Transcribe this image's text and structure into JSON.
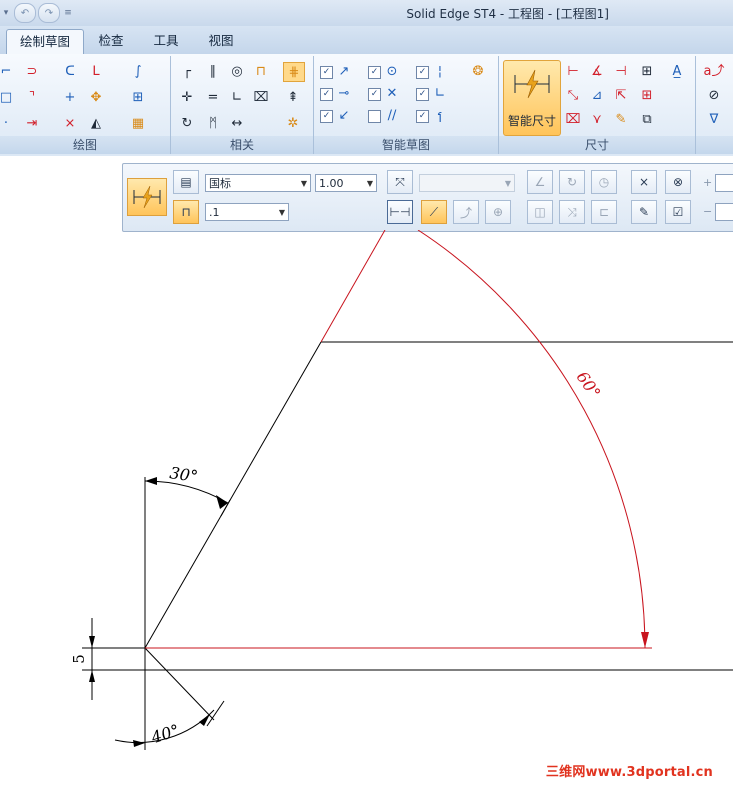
{
  "window": {
    "title": "Solid Edge ST4 - 工程图 - [工程图1]"
  },
  "tabs": [
    {
      "label": "绘制草图",
      "active": true
    },
    {
      "label": "检查",
      "active": false
    },
    {
      "label": "工具",
      "active": false
    },
    {
      "label": "视图",
      "active": false
    }
  ],
  "ribbon": {
    "groups": {
      "draw": "绘图",
      "relate": "相关",
      "intellisketch": "智能草图",
      "dimension": "尺寸"
    },
    "smart_dimension_label": "智能尺寸"
  },
  "command_bar": {
    "standard": "国标",
    "scale": "1.00",
    "precision": ".1",
    "right_fields": [
      "+",
      "−"
    ]
  },
  "drawing": {
    "angles": [
      "30°",
      "60°",
      "40°"
    ],
    "linear": "5"
  },
  "watermark": "三维网www.3dportal.cn",
  "colors": {
    "accent": "#ffc45a",
    "dimension_red": "#c8141e",
    "geometry": "#000000"
  }
}
